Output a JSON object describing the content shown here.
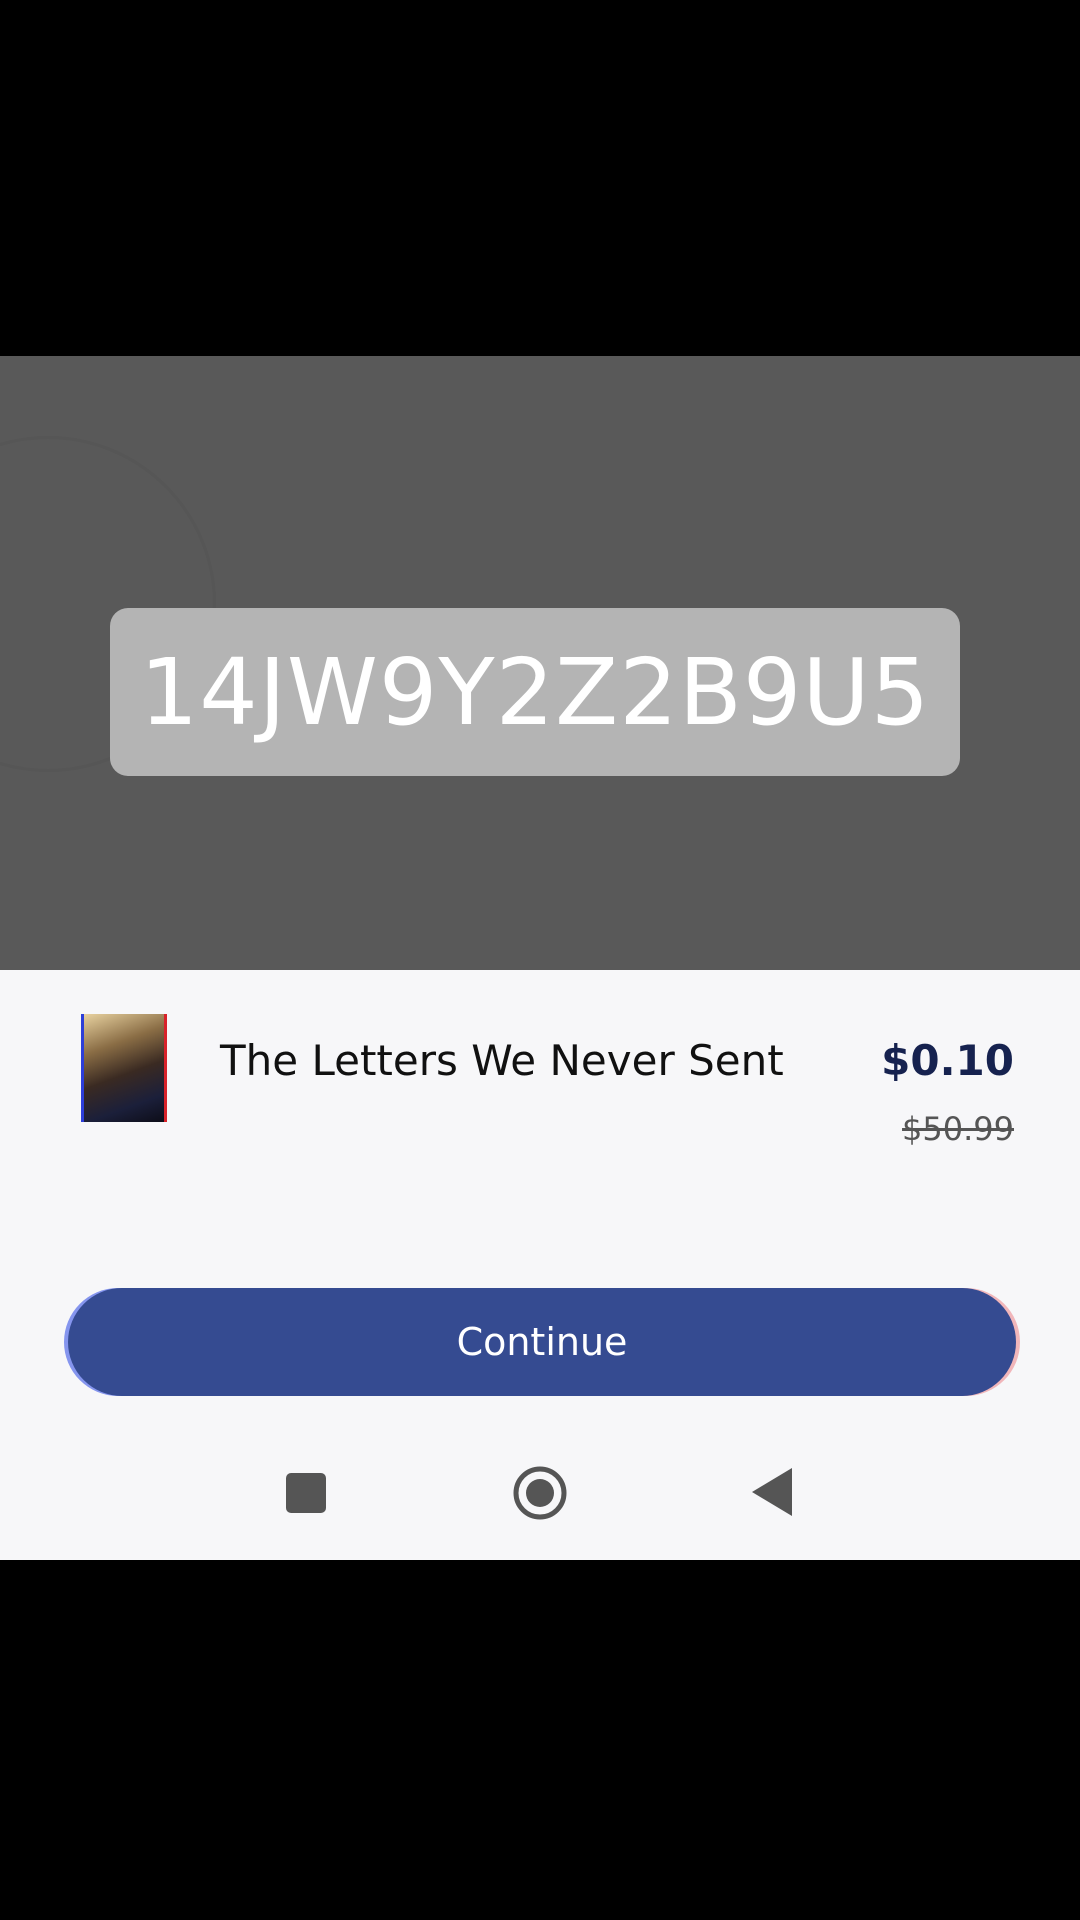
{
  "promo": {
    "code": "14JW9Y2Z2B9U5"
  },
  "item": {
    "title": "The Letters We Never Sent",
    "price": "$0.10",
    "original_price": "$50.99",
    "thumbnail_icon": "book-cover"
  },
  "actions": {
    "continue_label": "Continue"
  },
  "navigation": {
    "icons": [
      "recents-square-icon",
      "home-circle-icon",
      "back-triangle-icon"
    ]
  },
  "colors": {
    "accent": "#354b91",
    "scrim": "#595959",
    "chip": "#b4b4b4",
    "sheet": "#f7f7f9"
  }
}
